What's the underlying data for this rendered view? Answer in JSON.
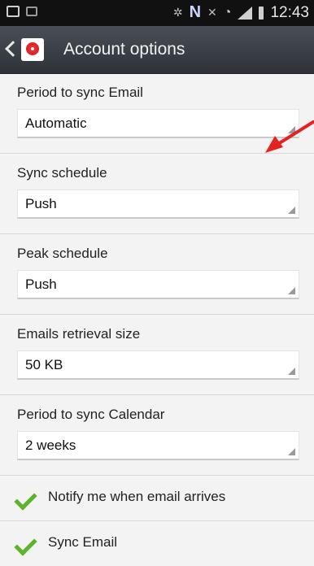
{
  "status_bar": {
    "n_label": "N",
    "time": "12:43"
  },
  "app_bar": {
    "title": "Account options"
  },
  "settings": [
    {
      "label": "Period to sync Email",
      "value": "Automatic"
    },
    {
      "label": "Sync schedule",
      "value": "Push"
    },
    {
      "label": "Peak schedule",
      "value": "Push"
    },
    {
      "label": "Emails retrieval size",
      "value": "50 KB"
    },
    {
      "label": "Period to sync Calendar",
      "value": "2 weeks"
    }
  ],
  "checkboxes": [
    {
      "label": "Notify me when email arrives",
      "checked": true
    },
    {
      "label": "Sync Email",
      "checked": true
    }
  ],
  "colors": {
    "check": "#5fb32c",
    "annotation": "#e32222",
    "app_icon": "#e2252b"
  }
}
